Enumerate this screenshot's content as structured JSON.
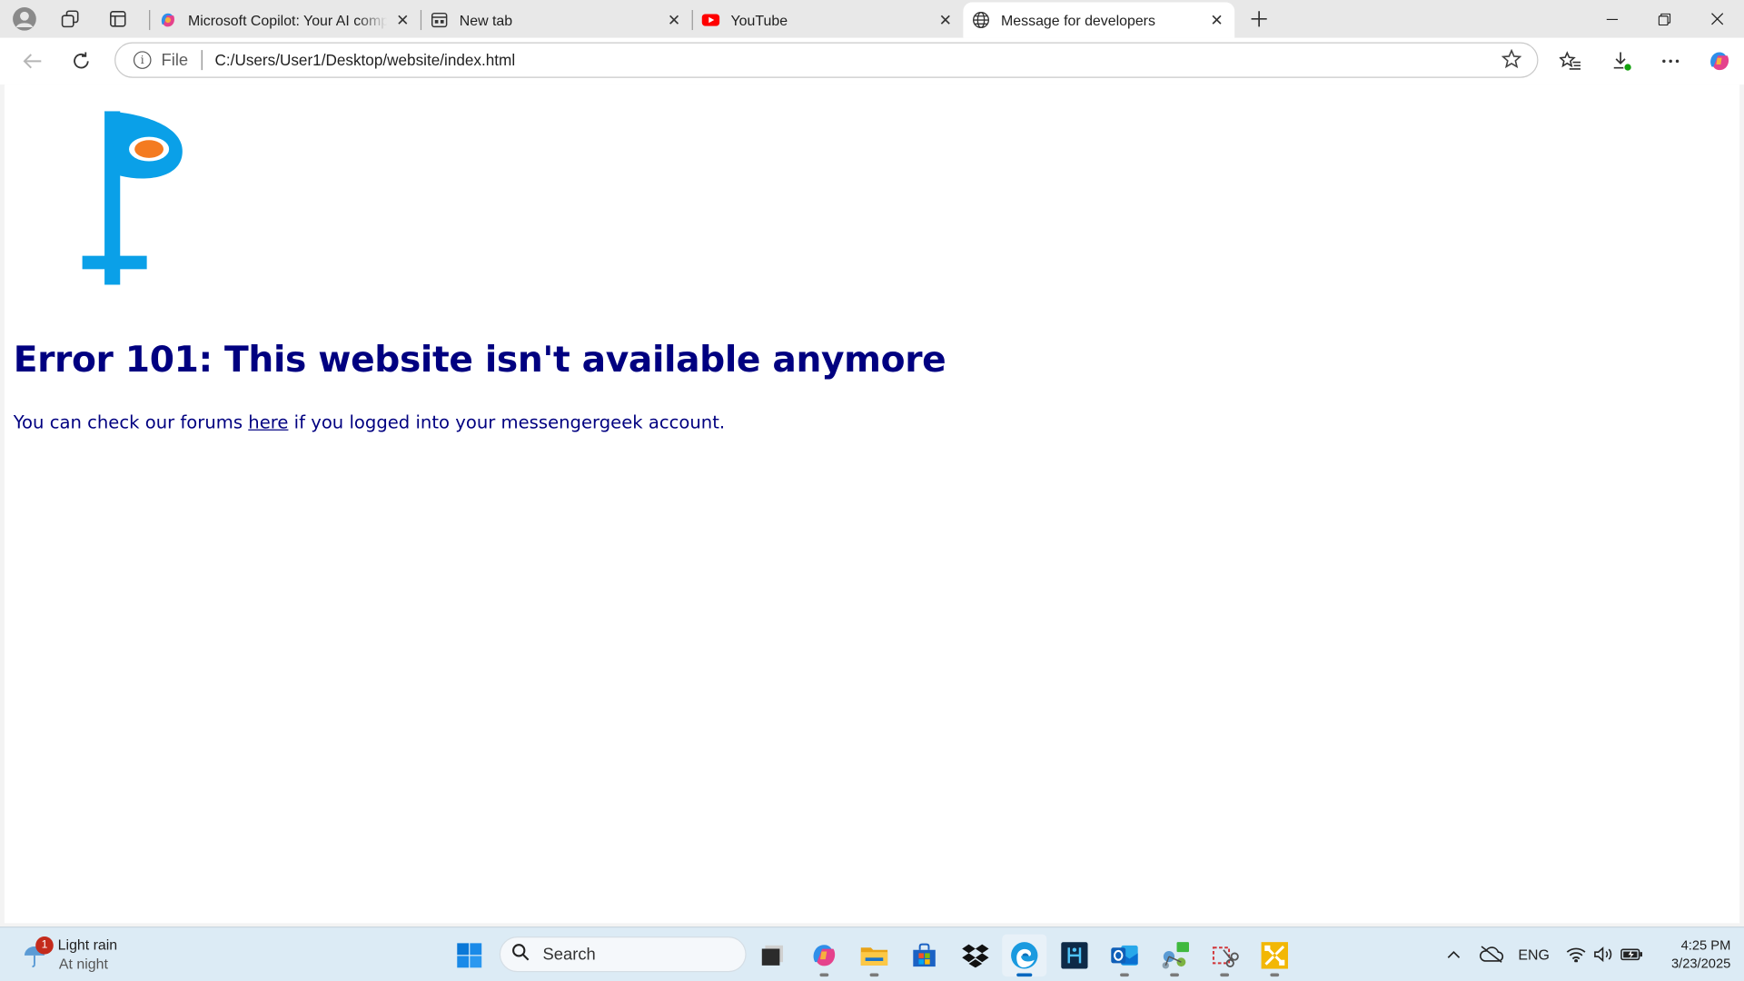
{
  "browser": {
    "tabs": [
      {
        "title": "Microsoft Copilot: Your AI companion",
        "icon": "copilot-icon",
        "active": false
      },
      {
        "title": "New tab",
        "icon": "new-tab-icon",
        "active": false
      },
      {
        "title": "YouTube",
        "icon": "youtube-icon",
        "active": false
      },
      {
        "title": "Message for developers",
        "icon": "globe-icon",
        "active": true
      }
    ],
    "address": {
      "scheme_label": "File",
      "url": "C:/Users/User1/Desktop/website/index.html"
    }
  },
  "page": {
    "heading": "Error 101: This website isn't available anymore",
    "text_before": "You can check our forums ",
    "link_text": "here",
    "text_after": " if you logged into your messengergeek account.",
    "logo_colors": {
      "primary": "#0aa0e8",
      "accent": "#f47b20"
    },
    "text_color": "#000080"
  },
  "taskbar": {
    "weather": {
      "condition": "Light rain",
      "period": "At night",
      "badge": "1"
    },
    "search_placeholder": "Search",
    "tray": {
      "language": "ENG"
    },
    "clock": {
      "time": "4:25 PM",
      "date": "3/23/2025"
    }
  }
}
